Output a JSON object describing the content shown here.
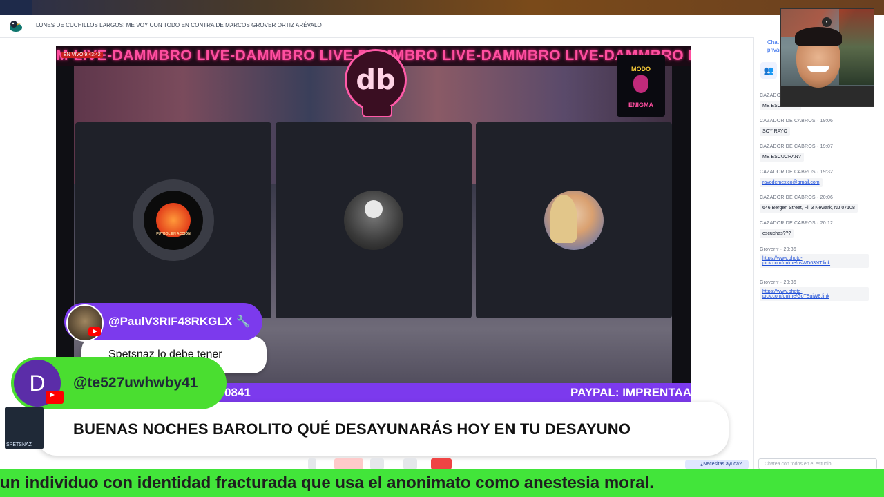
{
  "header": {
    "title": "LUNES DE CUCHILLOS LARGOS: ME VOY CON TODO EN CONTRA DE MARCOS GROVER ORTIZ ARÉVALO"
  },
  "stage": {
    "marquee_text": "M-LIVE-DAMMBRO LIVE-DAMMBRO LIVE-DAMMBRO LIVE-DAMMBRO LIVE-DAMMBRO LIVE-",
    "live_badge": "EN VIVO 9:43:42",
    "brand_logo": "db",
    "side_logo_top": "MODO",
    "side_logo_bottom": "ENIGMA",
    "ticker_left": "0841",
    "ticker_right": "PAYPAL: IMPRENTAA",
    "tiles": [
      {
        "avatar_label": "FÚTBOL EN ACCIÓN"
      },
      {
        "avatar_label": ""
      },
      {
        "avatar_label": ""
      }
    ]
  },
  "overlays": {
    "comment1": {
      "author": "@PaulV3RIF48RKGLX",
      "text": "Spetsnaz lo debe tener"
    },
    "comment2": {
      "author": "@te527uwhwby41",
      "avatar_letter": "D",
      "text": "BUENAS NOCHES BAROLITO QUÉ DESAYUNARÁS HOY EN TU DESAYUNO"
    },
    "bottom_ticker": "un individuo con identidad fracturada que usa el anonimato como anestesia moral."
  },
  "small_tile": {
    "label": "SPETSNAZ"
  },
  "toolbar": {
    "help_label": "¿Necesitas ayuda?"
  },
  "chat": {
    "tab_label": "Chat privado",
    "input_placeholder": "Chatea con todos en el estudio",
    "messages": [
      {
        "meta": "CAZADOR DE CABROS",
        "text": "ME ESCUCHAN",
        "link": false
      },
      {
        "meta": "CAZADOR DE CABROS · 19:06",
        "text": "SOY RAYO",
        "link": false
      },
      {
        "meta": "CAZADOR DE CABROS · 19:07",
        "text": "ME ESCUCHAN?",
        "link": false
      },
      {
        "meta": "CAZADOR DE CABROS · 19:32",
        "text": "rayodemexico@gmail.com",
        "link": true
      },
      {
        "meta": "CAZADOR DE CABROS · 20:06",
        "text": "646 Bergen Street, Fl. 3 Newark, NJ 07108",
        "link": false
      },
      {
        "meta": "CAZADOR DE CABROS · 20:12",
        "text": "escuchas???",
        "link": false
      },
      {
        "meta": "Groverrr · 20:36",
        "text": "https://www.photo-pick.com/online/nsWD63NT.link",
        "link": true
      },
      {
        "meta": "Groverrr · 20:36",
        "text": "https://www.photo-pick.com/online/GoTEqiW8.link",
        "link": true
      }
    ]
  },
  "colors": {
    "accent_purple": "#7c3aed",
    "accent_green": "#42e53a",
    "neon_pink": "#ff4fa0",
    "link_blue": "#1d4ed8"
  }
}
